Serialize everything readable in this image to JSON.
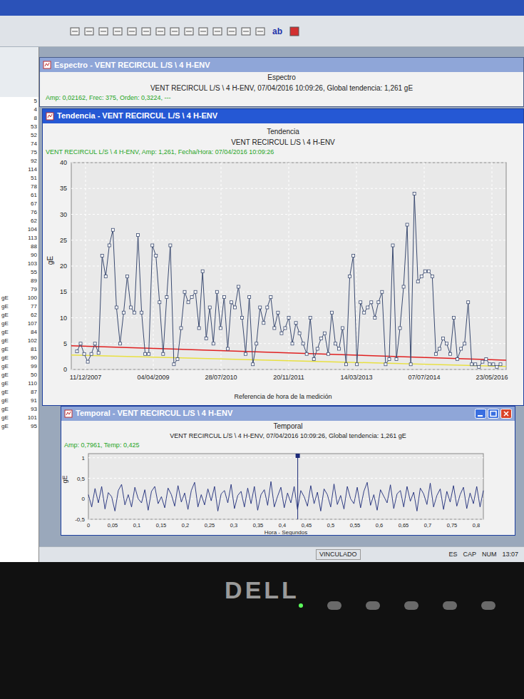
{
  "toolbar": {
    "text_button": "ab"
  },
  "left_panel": {
    "items": [
      {
        "unit": "",
        "value": "5"
      },
      {
        "unit": "",
        "value": "4"
      },
      {
        "unit": "",
        "value": "8"
      },
      {
        "unit": "",
        "value": "53"
      },
      {
        "unit": "",
        "value": "52"
      },
      {
        "unit": "",
        "value": "74"
      },
      {
        "unit": "",
        "value": "75"
      },
      {
        "unit": "",
        "value": "92"
      },
      {
        "unit": "",
        "value": "114"
      },
      {
        "unit": "",
        "value": "51"
      },
      {
        "unit": "",
        "value": "78"
      },
      {
        "unit": "",
        "value": "61"
      },
      {
        "unit": "",
        "value": "67"
      },
      {
        "unit": "",
        "value": "76"
      },
      {
        "unit": "",
        "value": "62"
      },
      {
        "unit": "",
        "value": "104"
      },
      {
        "unit": "",
        "value": "113"
      },
      {
        "unit": "",
        "value": "88"
      },
      {
        "unit": "",
        "value": "90"
      },
      {
        "unit": "",
        "value": "103"
      },
      {
        "unit": "",
        "value": "55"
      },
      {
        "unit": "",
        "value": "89"
      },
      {
        "unit": "",
        "value": "79"
      },
      {
        "unit": "gE",
        "value": "100"
      },
      {
        "unit": "gE",
        "value": "77"
      },
      {
        "unit": "gE",
        "value": "62"
      },
      {
        "unit": "gE",
        "value": "107"
      },
      {
        "unit": "gE",
        "value": "84"
      },
      {
        "unit": "gE",
        "value": "102"
      },
      {
        "unit": "gE",
        "value": "81"
      },
      {
        "unit": "gE",
        "value": "90"
      },
      {
        "unit": "gE",
        "value": "99"
      },
      {
        "unit": "gE",
        "value": "50"
      },
      {
        "unit": "gE",
        "value": "110"
      },
      {
        "unit": "gE",
        "value": "87"
      },
      {
        "unit": "gE",
        "value": "91"
      },
      {
        "unit": "gE",
        "value": "93"
      },
      {
        "unit": "gE",
        "value": "101"
      },
      {
        "unit": "gE",
        "value": "95"
      }
    ]
  },
  "spectrum_window": {
    "title": "Espectro - VENT RECIRCUL L/S \\ 4 H-ENV",
    "cursor": "Amp: 0,02162, Frec: 375, Orden: 0,3224, ---",
    "heading": "Espectro",
    "subtitle": "VENT RECIRCUL L/S \\ 4 H-ENV, 07/04/2016 10:09:26, Global tendencia: 1,261 gE"
  },
  "trend_window": {
    "title": "Tendencia - VENT RECIRCUL L/S \\ 4 H-ENV",
    "heading": "Tendencia",
    "subtitle": "VENT RECIRCUL L/S \\ 4 H-ENV",
    "cursor": "VENT RECIRCUL L/S \\ 4 H-ENV, Amp: 1,261, Fecha/Hora: 07/04/2016 10:09:26",
    "chart": {
      "y_label": "gE",
      "y_max": 40,
      "y_ticks": [
        {
          "label": "0",
          "value": 0
        },
        {
          "label": "5",
          "value": 5
        },
        {
          "label": "10",
          "value": 10
        },
        {
          "label": "15",
          "value": 15
        },
        {
          "label": "20",
          "value": 20
        },
        {
          "label": "25",
          "value": 25
        },
        {
          "label": "30",
          "value": 30
        },
        {
          "label": "35",
          "value": 35
        },
        {
          "label": "40",
          "value": 40
        }
      ],
      "x_ticks": [
        "11/12/2007",
        "04/04/2009",
        "28/07/2010",
        "20/11/2011",
        "14/03/2013",
        "07/07/2014",
        "23/05/2016"
      ],
      "x_title": "Referencia de hora de la medición",
      "alarms": [
        {
          "start": 4.6,
          "end": 1.8,
          "color": "#e02020"
        },
        {
          "start": 2.8,
          "end": 0.6,
          "color": "#e8e040"
        }
      ],
      "series": [
        3.5,
        5,
        3,
        1.5,
        3,
        5,
        3.2,
        22,
        18,
        24,
        27,
        12,
        5,
        11,
        18,
        12,
        11,
        26,
        11,
        3,
        3,
        24,
        22,
        13,
        3,
        14,
        24,
        1,
        2,
        8,
        15,
        13,
        14,
        15,
        8,
        19,
        6,
        12,
        5,
        15,
        8,
        14,
        4,
        13,
        12,
        16,
        10,
        3,
        14,
        1,
        5,
        12,
        9,
        12,
        14,
        8,
        11,
        7,
        8,
        10,
        5,
        9,
        7,
        5,
        3,
        10,
        2,
        4,
        6,
        7,
        3,
        11,
        5,
        4,
        8,
        1,
        18,
        22,
        1,
        13,
        11,
        12,
        13,
        10,
        13,
        15,
        1,
        2,
        24,
        2,
        8,
        16,
        28,
        1,
        34,
        17,
        18,
        19,
        19,
        18,
        3,
        4,
        6,
        5,
        3,
        10,
        2,
        4,
        5,
        13,
        1,
        1,
        0.5,
        1.5,
        2,
        1,
        1,
        0.5,
        1
      ]
    }
  },
  "time_window": {
    "title": "Temporal - VENT RECIRCUL L/S \\ 4 H-ENV",
    "cursor": "Amp: 0,7961, Temp: 0,425",
    "heading": "Temporal",
    "subtitle": "VENT RECIRCUL L/S \\ 4 H-ENV, 07/04/2016 10:09:26, Global tendencia: 1,261 gE",
    "chart": {
      "y_label": "gE",
      "y_min": -0.5,
      "y_max": 1.1,
      "y_ticks": [
        {
          "label": "1",
          "value": 1
        },
        {
          "label": "0,5",
          "value": 0.5
        },
        {
          "label": "0",
          "value": 0
        },
        {
          "label": "-0,5",
          "value": -0.5
        }
      ],
      "x_ticks": [
        "0",
        "0,05",
        "0,1",
        "0,15",
        "0,2",
        "0,25",
        "0,3",
        "0,35",
        "0,4",
        "0,45",
        "0,5",
        "0,55",
        "0,6",
        "0,65",
        "0,7",
        "0,75",
        "0,8"
      ],
      "x_title": "Hora - Segundos",
      "cursor_position": 0.53,
      "series": [
        0.1,
        -0.2,
        0.25,
        -0.1,
        0.3,
        -0.25,
        0.15,
        0.05,
        -0.3,
        0.2,
        0.35,
        -0.15,
        0.1,
        -0.2,
        0.28,
        0.0,
        -0.1,
        0.22,
        -0.28,
        0.18,
        0.3,
        -0.12,
        0.05,
        -0.22,
        0.26,
        0.1,
        -0.18,
        0.32,
        -0.08,
        0.14,
        -0.26,
        0.2,
        0.4,
        -0.2,
        0.1,
        -0.15,
        0.24,
        -0.05,
        0.3,
        -0.3,
        0.12,
        0.2,
        -0.1,
        0.35,
        -0.24,
        0.08,
        0.18,
        -0.2,
        0.26,
        -0.12,
        0.3,
        -0.28,
        0.1,
        0.22,
        -0.16,
        0.42,
        -0.2,
        0.06,
        0.28,
        -0.22,
        0.14,
        -0.1,
        0.3,
        -0.26,
        0.2,
        0.05,
        -0.18,
        0.32,
        -0.12,
        0.16,
        -0.3,
        0.24,
        0.1,
        -0.2,
        0.36,
        -0.14,
        0.08,
        -0.25,
        0.3,
        0.0,
        -0.12,
        0.28,
        -0.22,
        0.18,
        0.4,
        -0.16,
        0.1,
        -0.28,
        0.22,
        0.06,
        -0.1,
        0.34,
        -0.24,
        0.12,
        0.2,
        -0.2,
        0.3,
        -0.06,
        0.16,
        -0.3,
        0.26,
        0.12,
        -0.14,
        0.38,
        -0.2,
        0.08,
        0.24,
        -0.26,
        0.18,
        -0.08,
        0.32,
        -0.18,
        0.1,
        0.28,
        -0.24,
        0.14,
        -0.12,
        0.3,
        -0.2,
        0.2
      ]
    }
  },
  "status_bar": {
    "left": "VINCULADO",
    "right": [
      "ES",
      "CAP",
      "NUM",
      "13:07"
    ]
  },
  "monitor": {
    "brand": "DELL"
  }
}
